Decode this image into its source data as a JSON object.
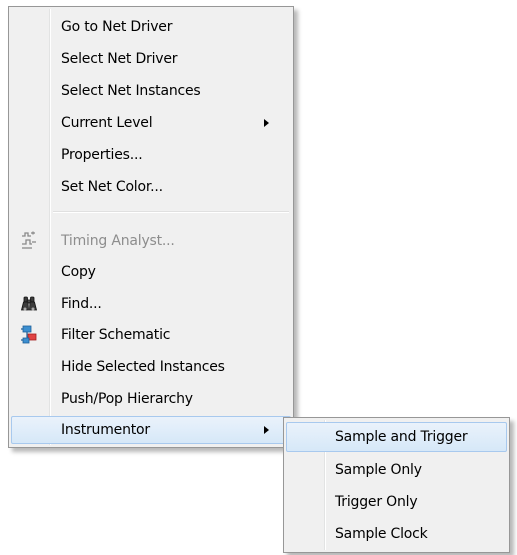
{
  "main_menu": {
    "items": [
      {
        "label": "Go to Net Driver"
      },
      {
        "label": "Select Net Driver"
      },
      {
        "label": "Select Net Instances"
      },
      {
        "label": "Current Level"
      },
      {
        "label": "Properties..."
      },
      {
        "label": "Set Net Color..."
      },
      {
        "label": "Timing Analyst...",
        "icon": "timing-analyst-icon",
        "disabled": true
      },
      {
        "label": "Copy"
      },
      {
        "label": "Find...",
        "icon": "binoculars-icon"
      },
      {
        "label": "Filter Schematic",
        "icon": "filter-schematic-icon"
      },
      {
        "label": "Hide Selected Instances"
      },
      {
        "label": "Push/Pop Hierarchy"
      },
      {
        "label": "Instrumentor",
        "highlighted": true
      }
    ]
  },
  "submenu": {
    "items": [
      {
        "label": "Sample and Trigger",
        "highlighted": true
      },
      {
        "label": "Sample Only"
      },
      {
        "label": "Trigger Only"
      },
      {
        "label": "Sample Clock"
      }
    ]
  },
  "colors": {
    "menu_bg": "#f0f0f0",
    "highlight_border": "#a8c9ee",
    "disabled_text": "#8d8d8d"
  }
}
